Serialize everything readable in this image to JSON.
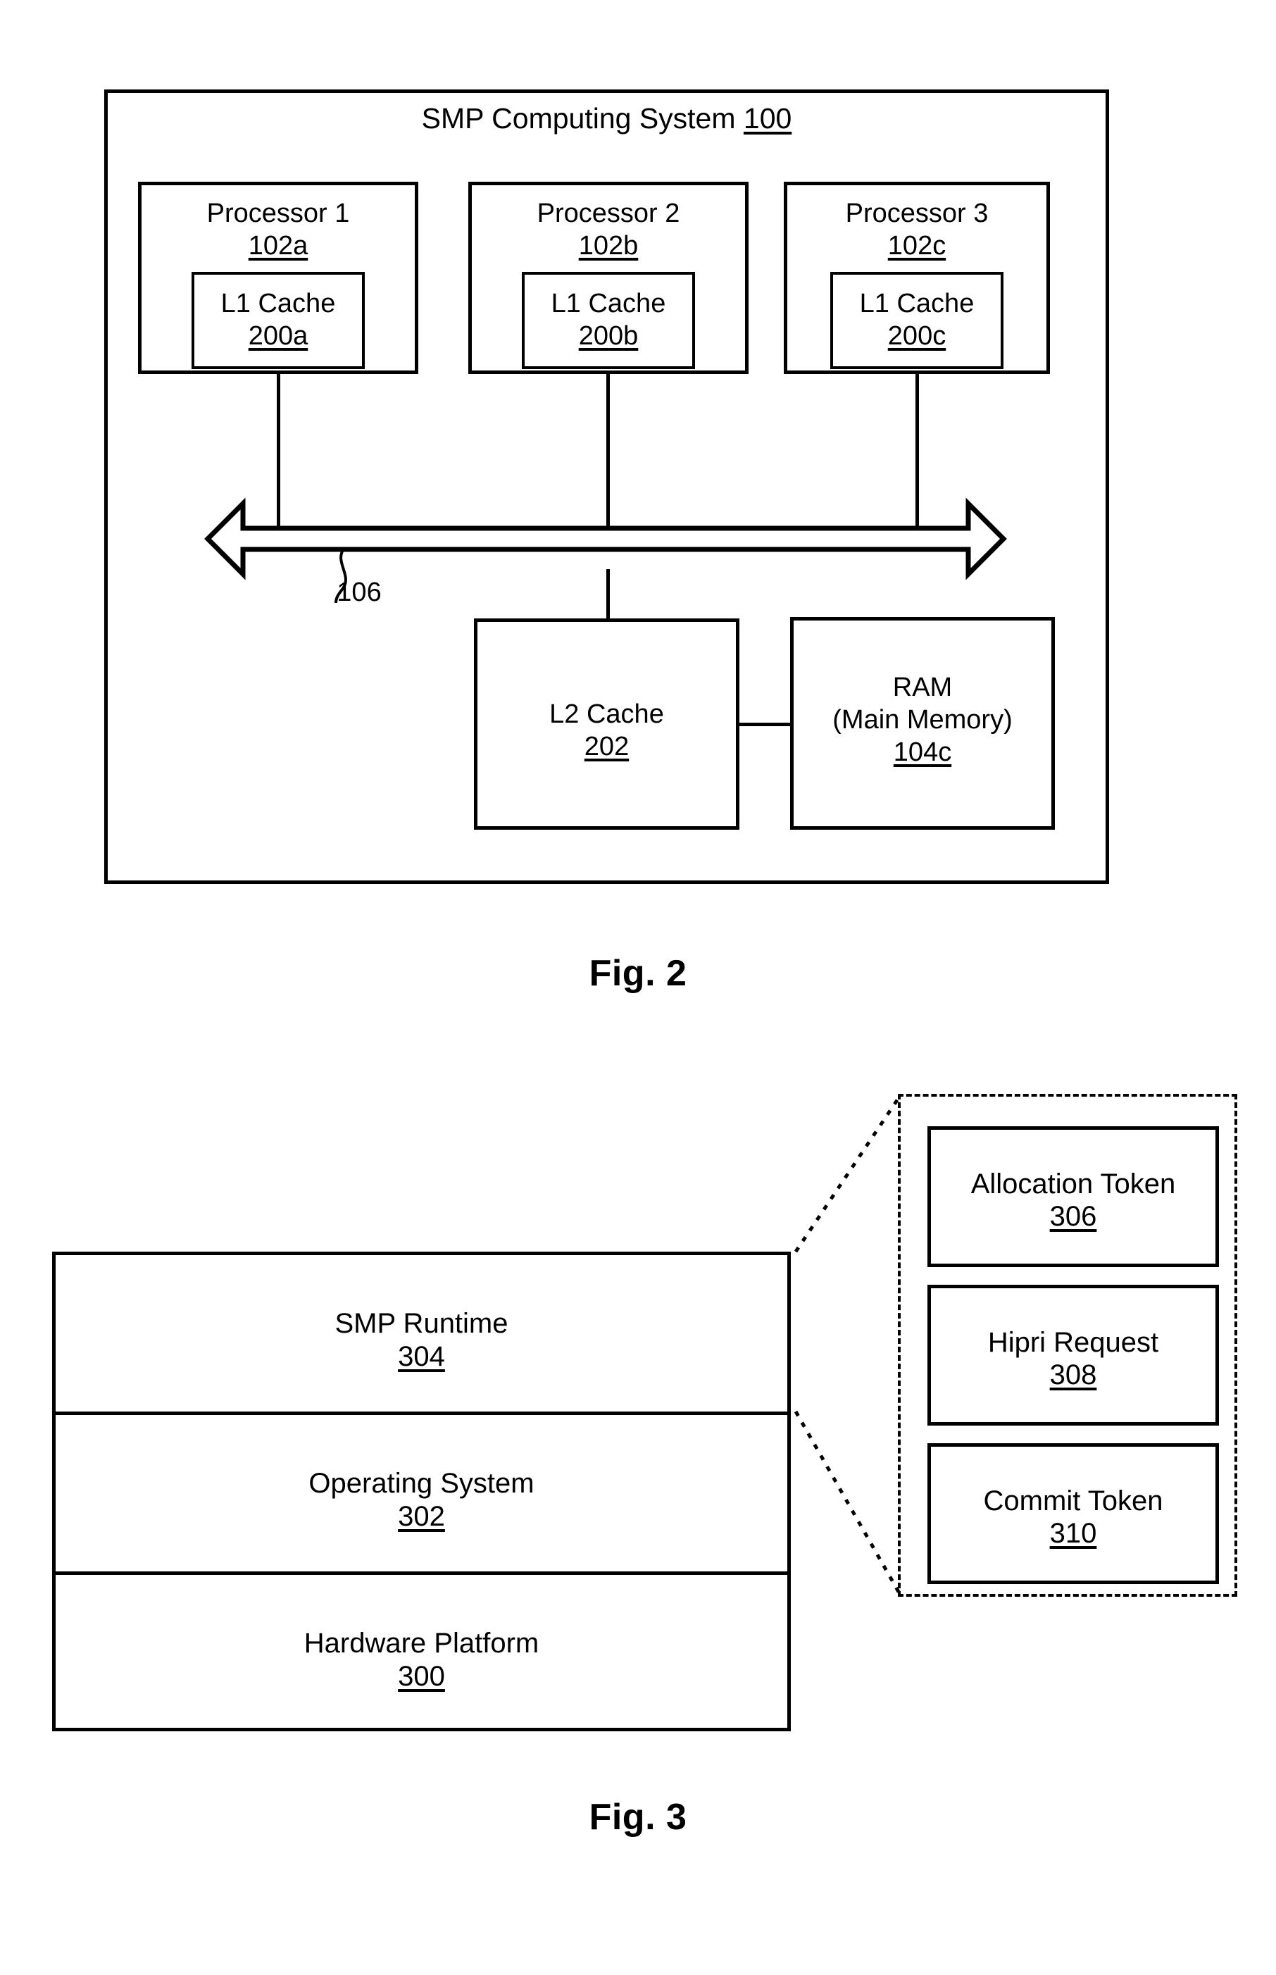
{
  "figure2": {
    "caption": "Fig. 2",
    "title": "SMP Computing System",
    "title_ref": "100",
    "processors": [
      {
        "title": "Processor 1",
        "ref": "102a",
        "cache_title": "L1 Cache",
        "cache_ref": "200a"
      },
      {
        "title": "Processor 2",
        "ref": "102b",
        "cache_title": "L1 Cache",
        "cache_ref": "200b"
      },
      {
        "title": "Processor 3",
        "ref": "102c",
        "cache_title": "L1 Cache",
        "cache_ref": "200c"
      }
    ],
    "bus": {
      "ref": "106"
    },
    "l2_cache": {
      "title": "L2 Cache",
      "ref": "202"
    },
    "ram": {
      "title": "RAM",
      "subtitle": "(Main Memory)",
      "ref": "104c"
    }
  },
  "figure3": {
    "caption": "Fig. 3",
    "stack": [
      {
        "title": "SMP Runtime",
        "ref": "304"
      },
      {
        "title": "Operating System",
        "ref": "302"
      },
      {
        "title": "Hardware Platform",
        "ref": "300"
      }
    ],
    "tokens": [
      {
        "title": "Allocation Token",
        "ref": "306"
      },
      {
        "title": "Hipri Request",
        "ref": "308"
      },
      {
        "title": "Commit Token",
        "ref": "310"
      }
    ]
  },
  "colors": {
    "ink": "#000000",
    "paper": "#ffffff"
  }
}
